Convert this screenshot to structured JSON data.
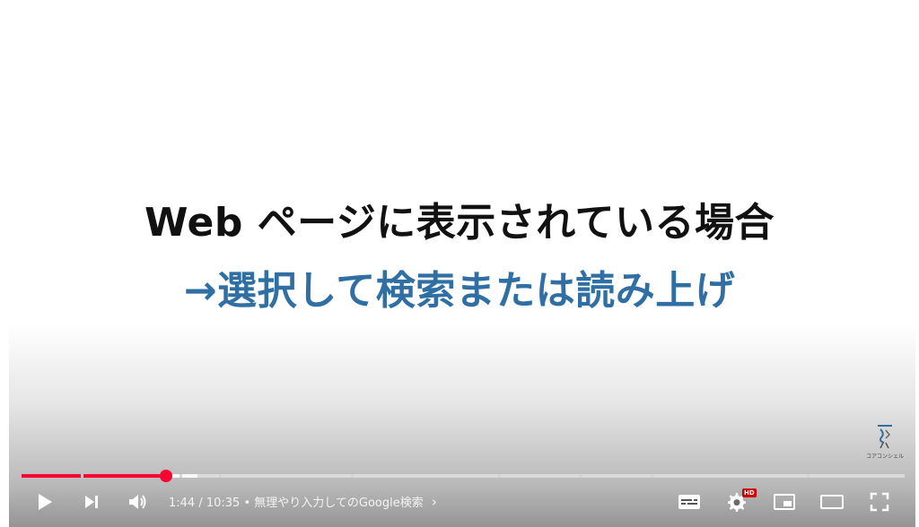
{
  "slide": {
    "line1": "Web ページに表示されている場合",
    "line2": "→選択して検索または読み上げ",
    "line1_color": "#111111",
    "line2_color": "#2f6fa3"
  },
  "watermark": {
    "text": "コアコンシェル"
  },
  "player": {
    "current_time": "1:44",
    "separator": " / ",
    "duration": "10:35",
    "chapter_prefix": " • ",
    "chapter_title": "無理やり入力してのGoogle検索",
    "chapter_chevron": "›",
    "hd_badge": "HD",
    "progress_played_fraction": 0.164,
    "progress_buffered_fraction": 0.19,
    "accent_color": "#ff0033"
  },
  "controls": {
    "play": "play-icon",
    "next": "next-icon",
    "volume": "volume-icon",
    "captions": "captions-icon",
    "settings": "gear-icon",
    "miniplayer": "miniplayer-icon",
    "theater": "theater-icon",
    "fullscreen": "fullscreen-icon"
  }
}
